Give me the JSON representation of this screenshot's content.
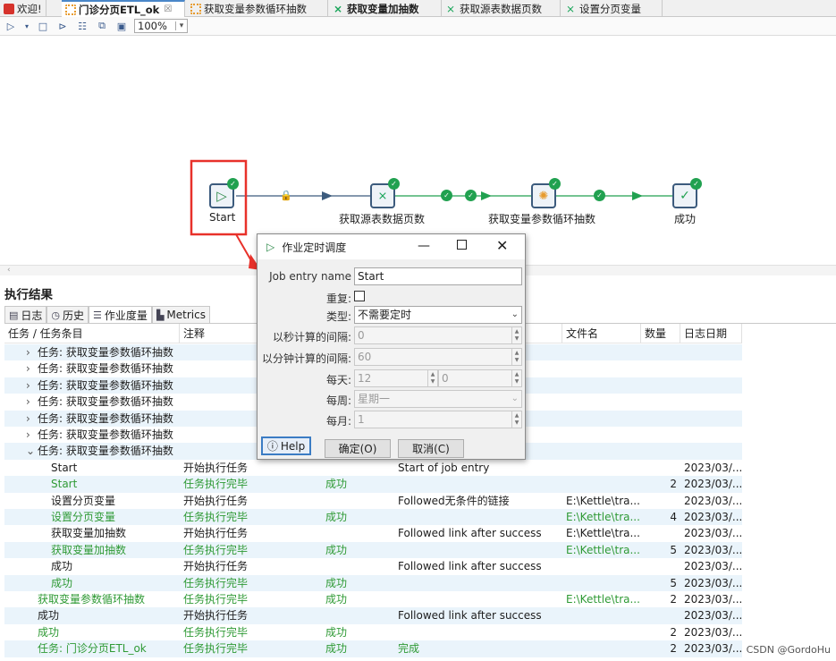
{
  "tabs": [
    {
      "label": "欢迎!",
      "icon": "spoon-icon",
      "active": false
    },
    {
      "label": "门诊分页ETL_ok",
      "icon": "job-icon",
      "active": true,
      "close": "☒"
    },
    {
      "label": "获取变量参数循环抽数",
      "icon": "job-icon",
      "active": false
    },
    {
      "label": "获取变量加抽数",
      "icon": "transformation-icon",
      "active": false
    },
    {
      "label": "获取源表数据页数",
      "icon": "transformation-icon",
      "active": false
    },
    {
      "label": "设置分页变量",
      "icon": "transformation-icon",
      "active": false
    }
  ],
  "toolbar": {
    "zoom": "100%"
  },
  "canvas": {
    "nodes": [
      {
        "label": "Start",
        "icon": "start-icon"
      },
      {
        "label": "获取源表数据页数",
        "icon": "transformation-icon"
      },
      {
        "label": "获取变量参数循环抽数",
        "icon": "job-icon"
      },
      {
        "label": "成功",
        "icon": "success-icon"
      }
    ]
  },
  "results": {
    "title": "执行结果",
    "tabs": [
      {
        "label": "日志",
        "icon": "log-icon"
      },
      {
        "label": "历史",
        "icon": "history-icon"
      },
      {
        "label": "作业度量",
        "icon": "job-metrics-icon"
      },
      {
        "label": "Metrics",
        "icon": "metrics-icon"
      }
    ],
    "columns": [
      "任务 / 任务条目",
      "注释",
      "",
      "",
      "文件名",
      "数量",
      "日志日期"
    ],
    "rows": [
      {
        "task": "任务: 获取变量参数循环抽数",
        "tree": "›",
        "comment": "",
        "result": "",
        "reason": "",
        "file": "",
        "count": "",
        "date": "",
        "green": false
      },
      {
        "task": "任务: 获取变量参数循环抽数",
        "tree": "›",
        "comment": "",
        "result": "",
        "reason": "",
        "file": "",
        "count": "",
        "date": "",
        "green": false
      },
      {
        "task": "任务: 获取变量参数循环抽数",
        "tree": "›",
        "comment": "",
        "result": "",
        "reason": "",
        "file": "",
        "count": "",
        "date": "",
        "green": false
      },
      {
        "task": "任务: 获取变量参数循环抽数",
        "tree": "›",
        "comment": "",
        "result": "",
        "reason": "",
        "file": "",
        "count": "",
        "date": "",
        "green": false
      },
      {
        "task": "任务: 获取变量参数循环抽数",
        "tree": "›",
        "comment": "",
        "result": "",
        "reason": "",
        "file": "",
        "count": "",
        "date": "",
        "green": false
      },
      {
        "task": "任务: 获取变量参数循环抽数",
        "tree": "›",
        "comment": "",
        "result": "",
        "reason": "",
        "file": "",
        "count": "",
        "date": "",
        "green": false
      },
      {
        "task": "任务: 获取变量参数循环抽数",
        "tree": "⌄",
        "comment": "",
        "result": "",
        "reason": "",
        "file": "",
        "count": "",
        "date": "",
        "green": false
      },
      {
        "task": "Start",
        "tree": "",
        "comment": "开始执行任务",
        "result": "",
        "reason": "Start of job entry",
        "file": "",
        "count": "",
        "date": "2023/03/...",
        "green": false
      },
      {
        "task": "Start",
        "tree": "",
        "comment": "任务执行完毕",
        "result": "成功",
        "reason": "",
        "file": "",
        "count": "2",
        "date": "2023/03/...",
        "green": true
      },
      {
        "task": "设置分页变量",
        "tree": "",
        "comment": "开始执行任务",
        "result": "",
        "reason": "Followed无条件的链接",
        "file": "E:\\Kettle\\tra...",
        "count": "",
        "date": "2023/03/...",
        "green": false
      },
      {
        "task": "设置分页变量",
        "tree": "",
        "comment": "任务执行完毕",
        "result": "成功",
        "reason": "",
        "file": "E:\\Kettle\\tra...",
        "count": "4",
        "date": "2023/03/...",
        "green": true
      },
      {
        "task": "获取变量加抽数",
        "tree": "",
        "comment": "开始执行任务",
        "result": "",
        "reason": "Followed link after success",
        "file": "E:\\Kettle\\tra...",
        "count": "",
        "date": "2023/03/...",
        "green": false
      },
      {
        "task": "获取变量加抽数",
        "tree": "",
        "comment": "任务执行完毕",
        "result": "成功",
        "reason": "",
        "file": "E:\\Kettle\\tra...",
        "count": "5",
        "date": "2023/03/...",
        "green": true
      },
      {
        "task": "成功",
        "tree": "",
        "comment": "开始执行任务",
        "result": "",
        "reason": "Followed link after success",
        "file": "",
        "count": "",
        "date": "2023/03/...",
        "green": false
      },
      {
        "task": "成功",
        "tree": "",
        "comment": "任务执行完毕",
        "result": "成功",
        "reason": "",
        "file": "",
        "count": "5",
        "date": "2023/03/...",
        "green": true
      },
      {
        "task": "获取变量参数循环抽数",
        "tree": "",
        "comment": "任务执行完毕",
        "result": "成功",
        "reason": "",
        "file": "E:\\Kettle\\tra...",
        "count": "2",
        "date": "2023/03/...",
        "green": true
      },
      {
        "task": "成功",
        "tree": "",
        "comment": "开始执行任务",
        "result": "",
        "reason": "Followed link after success",
        "file": "",
        "count": "",
        "date": "2023/03/...",
        "green": false
      },
      {
        "task": "成功",
        "tree": "",
        "comment": "任务执行完毕",
        "result": "成功",
        "reason": "",
        "file": "",
        "count": "2",
        "date": "2023/03/...",
        "green": true
      },
      {
        "task": "任务: 门诊分页ETL_ok",
        "tree": "",
        "comment": "任务执行完毕",
        "result": "成功",
        "reason": "完成",
        "file": "",
        "count": "2",
        "date": "2023/03/...",
        "green": true
      }
    ]
  },
  "dialog": {
    "title": "作业定时调度",
    "fields": {
      "name_label": "Job entry name",
      "name_value": "Start",
      "repeat_label": "重复:",
      "type_label": "类型:",
      "type_value": "不需要定时",
      "sec_label": "以秒计算的间隔:",
      "sec_value": "0",
      "min_label": "以分钟计算的间隔:",
      "min_value": "60",
      "day_label": "每天:",
      "day_hour": "12",
      "day_minute": "0",
      "week_label": "每周:",
      "week_value": "星期一",
      "month_label": "每月:",
      "month_value": "1"
    },
    "help": "Help",
    "ok": "确定(O)",
    "cancel": "取消(C)"
  },
  "watermark": "CSDN @GordoHu",
  "colors": {
    "success": "#21a150",
    "highlight": "#e8312a",
    "link": "#3a5a8c"
  }
}
